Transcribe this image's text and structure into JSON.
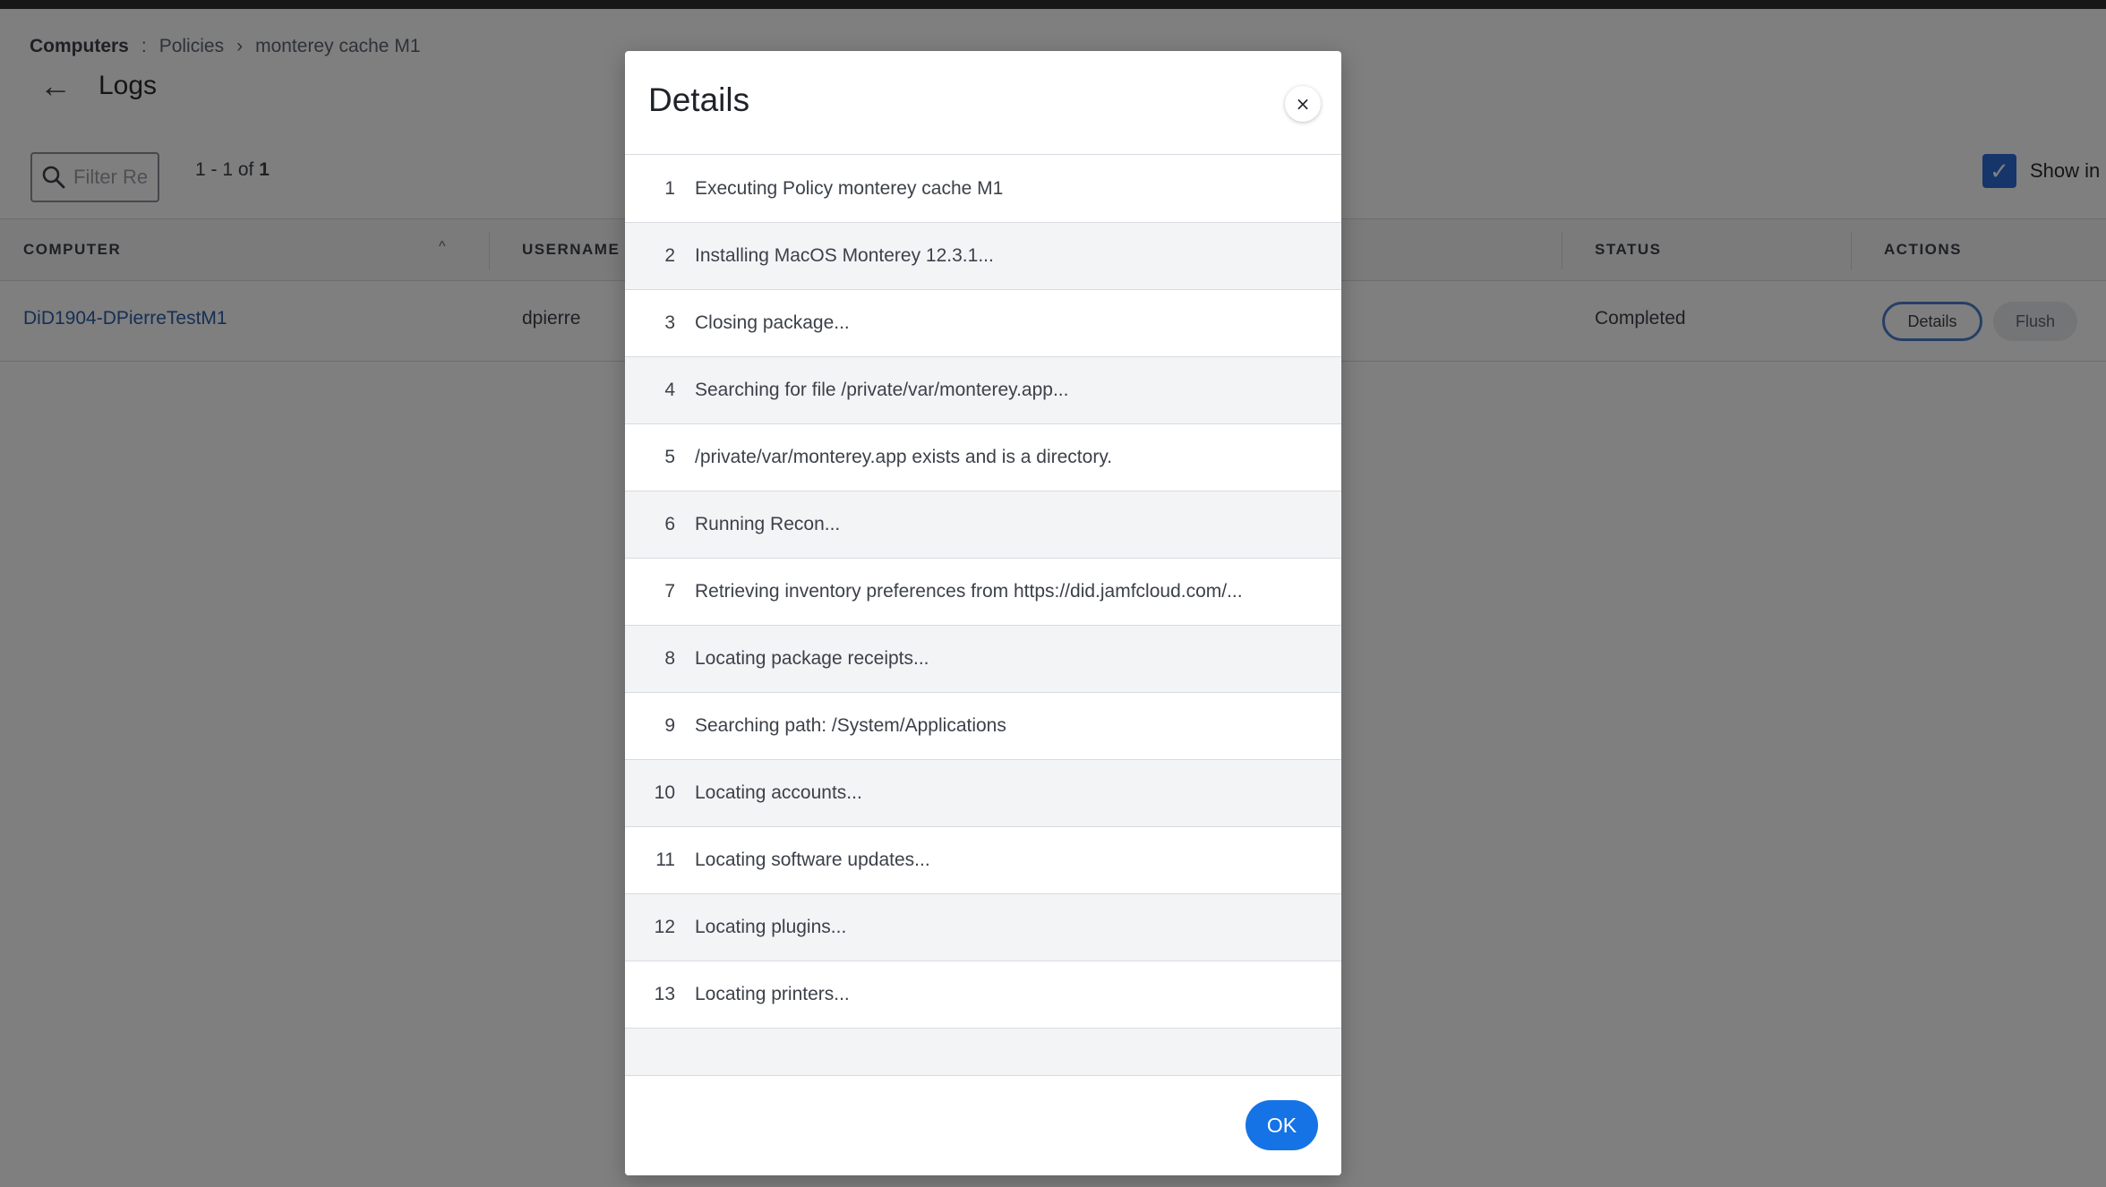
{
  "breadcrumb": {
    "root": "Computers",
    "separator": ":",
    "items": [
      "Policies",
      "monterey cache M1"
    ]
  },
  "page": {
    "title": "Logs"
  },
  "filter": {
    "placeholder": "Filter Re"
  },
  "pager": {
    "range": "1 - 1 of ",
    "total": "1"
  },
  "show_in": {
    "label": "Show in",
    "checked": true
  },
  "table": {
    "headers": {
      "computer": "COMPUTER",
      "username": "USERNAME",
      "status": "STATUS",
      "actions": "ACTIONS"
    },
    "rows": [
      {
        "computer": "DiD1904-DPierreTestM1",
        "username": "dpierre",
        "status": "Completed",
        "details_label": "Details",
        "flush_label": "Flush"
      }
    ]
  },
  "modal": {
    "title": "Details",
    "close_icon": "×",
    "ok_label": "OK",
    "log": [
      {
        "num": "1",
        "text": "Executing Policy monterey cache M1"
      },
      {
        "num": "2",
        "text": "Installing MacOS Monterey 12.3.1..."
      },
      {
        "num": "3",
        "text": "Closing package..."
      },
      {
        "num": "4",
        "text": "Searching for file /private/var/monterey.app..."
      },
      {
        "num": "5",
        "text": "/private/var/monterey.app exists and is a directory."
      },
      {
        "num": "6",
        "text": "Running Recon..."
      },
      {
        "num": "7",
        "text": "Retrieving inventory preferences from https://did.jamfcloud.com/..."
      },
      {
        "num": "8",
        "text": "Locating package receipts..."
      },
      {
        "num": "9",
        "text": "Searching path: /System/Applications"
      },
      {
        "num": "10",
        "text": "Locating accounts..."
      },
      {
        "num": "11",
        "text": "Locating software updates..."
      },
      {
        "num": "12",
        "text": "Locating plugins..."
      },
      {
        "num": "13",
        "text": "Locating printers..."
      },
      {
        "num": "",
        "text": ""
      }
    ]
  },
  "colors": {
    "accent": "#1573e6",
    "link": "#2d5fa8",
    "checkbox": "#2d6ad6"
  }
}
